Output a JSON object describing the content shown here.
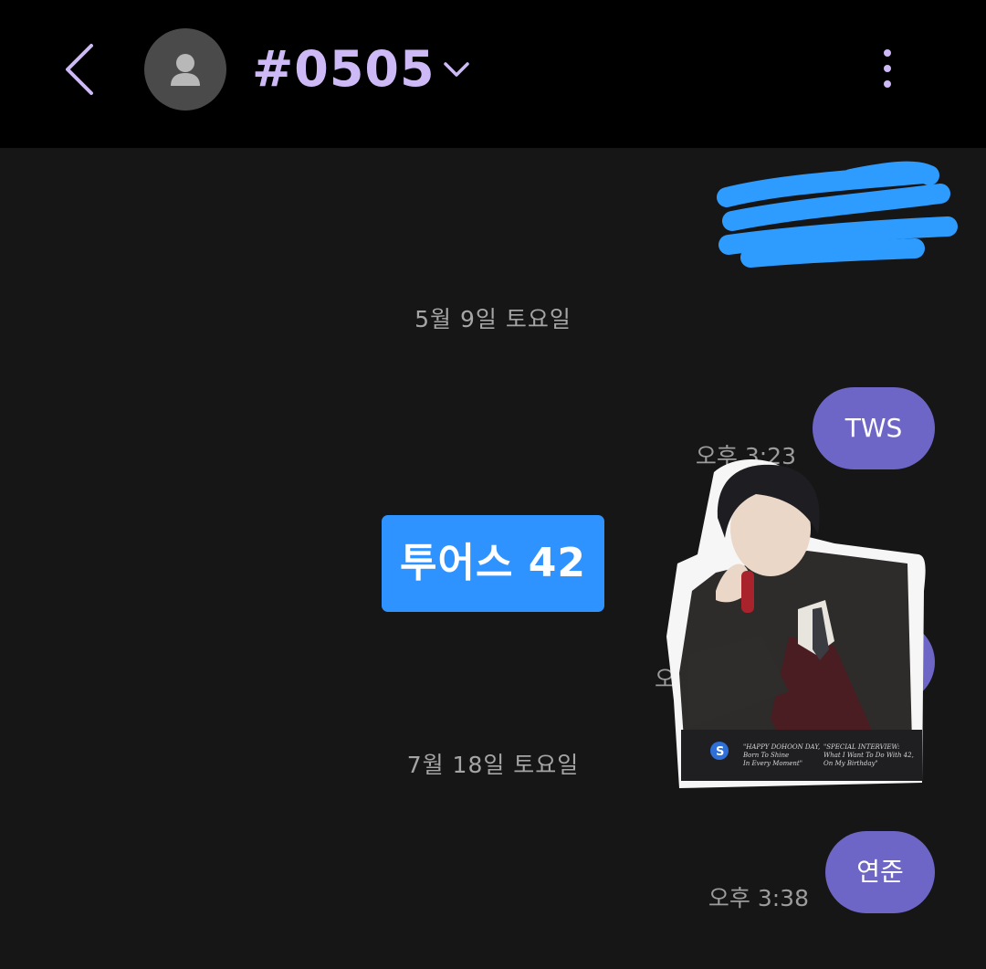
{
  "header": {
    "title": "#0505",
    "back_icon": "chevron-left-icon",
    "avatar_icon": "person-icon",
    "dropdown_icon": "chevron-down-icon",
    "more_icon": "vertical-dots-icon",
    "accent_color": "#cdb9f5"
  },
  "conversation": {
    "date_separators": [
      "5월 9일 토요일",
      "7월 18일 토요일"
    ],
    "messages": [
      {
        "text": "TWS",
        "time": "오후 3:23"
      },
      {
        "text": "",
        "time": "오"
      },
      {
        "text": "연준",
        "time": "오후 3:38"
      }
    ],
    "bubble_color": "#6e66c6"
  },
  "overlay_label": {
    "text": "투어스 42",
    "color": "#2f93ff"
  },
  "sticker": {
    "text_left": [
      "\"HAPPY DOHOON DAY,",
      "Born To Shine",
      "In Every Moment\""
    ],
    "text_right": [
      "\"SPECIAL INTERVIEW:",
      "What I Want To Do With 42,",
      "On My Birthday\""
    ]
  },
  "redaction_color": "#2e9bff"
}
